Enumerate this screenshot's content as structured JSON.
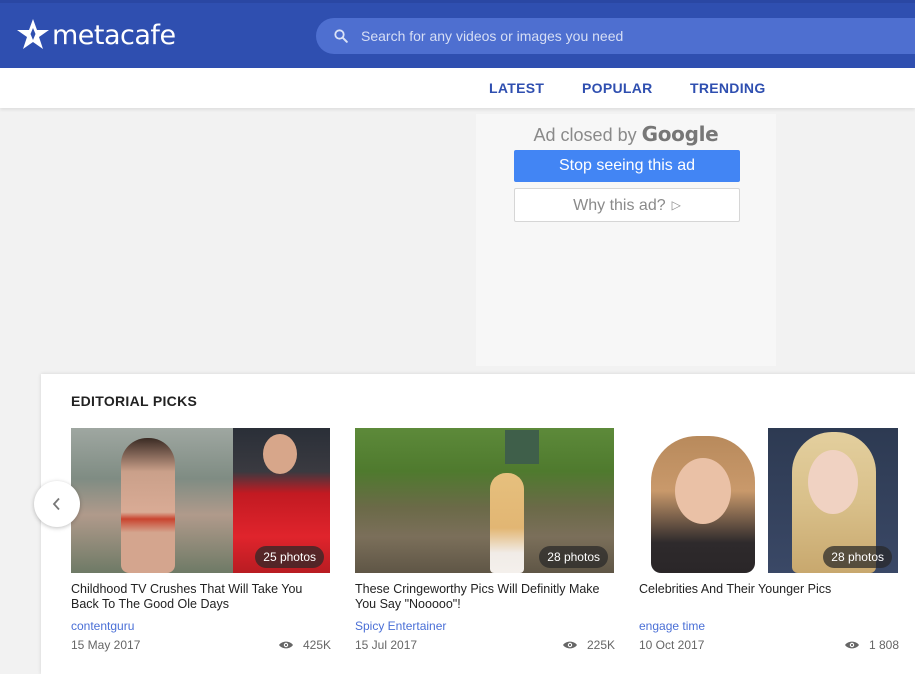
{
  "header": {
    "logo_text": "metacafe",
    "search": {
      "placeholder": "Search for any videos or images you need"
    }
  },
  "nav": {
    "items": [
      {
        "label": "LATEST"
      },
      {
        "label": "POPULAR"
      },
      {
        "label": "TRENDING"
      }
    ]
  },
  "ad": {
    "closed_prefix": "Ad closed by",
    "closed_brand": "Google",
    "stop_label": "Stop seeing this ad",
    "why_label": "Why this ad?"
  },
  "editorial": {
    "title": "EDITORIAL PICKS",
    "cards": [
      {
        "badge": "25 photos",
        "title": "Childhood TV Crushes That Will Take You Back To The Good Ole Days",
        "source": "contentguru",
        "date": "15 May 2017",
        "views": "425K"
      },
      {
        "badge": "28 photos",
        "title": "These Cringeworthy Pics Will Definitly Make You Say \"Nooooo\"!",
        "source": "Spicy Entertainer",
        "date": "15 Jul 2017",
        "views": "225K"
      },
      {
        "badge": "28 photos",
        "title": "Celebrities And Their Younger Pics",
        "source": "engage time",
        "date": "10 Oct 2017",
        "views": "1 808"
      }
    ]
  },
  "colors": {
    "brand_blue": "#2f4fb0",
    "search_bg": "#4e6fd0",
    "ad_button_blue": "#4285f4",
    "source_link": "#4a6fd6"
  }
}
